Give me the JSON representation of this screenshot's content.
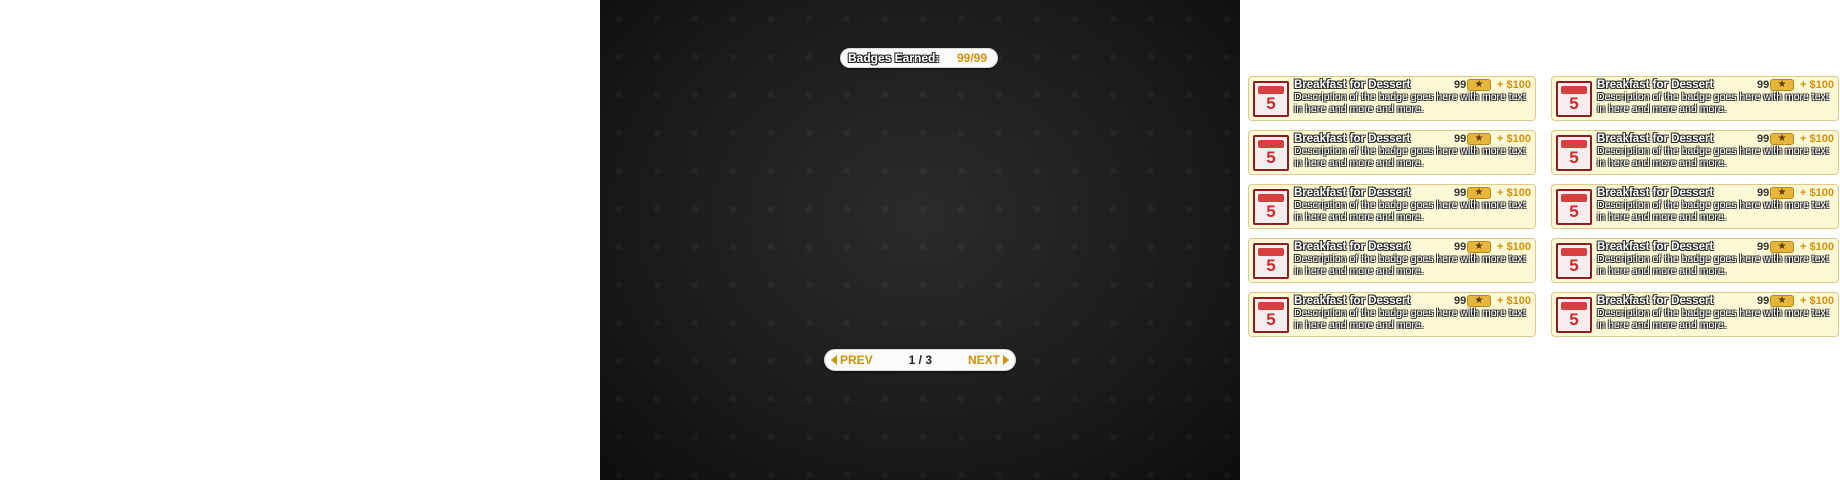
{
  "hud": {
    "badges_label": "Badges Earned:",
    "badges_value": "99/99"
  },
  "pager": {
    "prev_label": "PREV",
    "next_label": "NEXT",
    "page_indicator": "1 / 3"
  },
  "badges": [
    {
      "title": "Breakfast for Dessert",
      "points": "99",
      "star_icon": "star-icon",
      "reward": "+ $100",
      "description": "Description of the badge goes here with more text in here and more and more.",
      "icon_number": "5"
    },
    {
      "title": "Breakfast for Dessert",
      "points": "99",
      "star_icon": "star-icon",
      "reward": "+ $100",
      "description": "Description of the badge goes here with more text in here and more and more.",
      "icon_number": "5"
    },
    {
      "title": "Breakfast for Dessert",
      "points": "99",
      "star_icon": "star-icon",
      "reward": "+ $100",
      "description": "Description of the badge goes here with more text in here and more and more.",
      "icon_number": "5"
    },
    {
      "title": "Breakfast for Dessert",
      "points": "99",
      "star_icon": "star-icon",
      "reward": "+ $100",
      "description": "Description of the badge goes here with more text in here and more and more.",
      "icon_number": "5"
    },
    {
      "title": "Breakfast for Dessert",
      "points": "99",
      "star_icon": "star-icon",
      "reward": "+ $100",
      "description": "Description of the badge goes here with more text in here and more and more.",
      "icon_number": "5"
    },
    {
      "title": "Breakfast for Dessert",
      "points": "99",
      "star_icon": "star-icon",
      "reward": "+ $100",
      "description": "Description of the badge goes here with more text in here and more and more.",
      "icon_number": "5"
    },
    {
      "title": "Breakfast for Dessert",
      "points": "99",
      "star_icon": "star-icon",
      "reward": "+ $100",
      "description": "Description of the badge goes here with more text in here and more and more.",
      "icon_number": "5"
    },
    {
      "title": "Breakfast for Dessert",
      "points": "99",
      "star_icon": "star-icon",
      "reward": "+ $100",
      "description": "Description of the badge goes here with more text in here and more and more.",
      "icon_number": "5"
    },
    {
      "title": "Breakfast for Dessert",
      "points": "99",
      "star_icon": "star-icon",
      "reward": "+ $100",
      "description": "Description of the badge goes here with more text in here and more and more.",
      "icon_number": "5"
    },
    {
      "title": "Breakfast for Dessert",
      "points": "99",
      "star_icon": "star-icon",
      "reward": "+ $100",
      "description": "Description of the badge goes here with more text in here and more and more.",
      "icon_number": "5"
    }
  ],
  "colors": {
    "accent": "#d4900a",
    "card_bg": "#fdf8d5",
    "panel_bg": "#1c1c1c"
  }
}
